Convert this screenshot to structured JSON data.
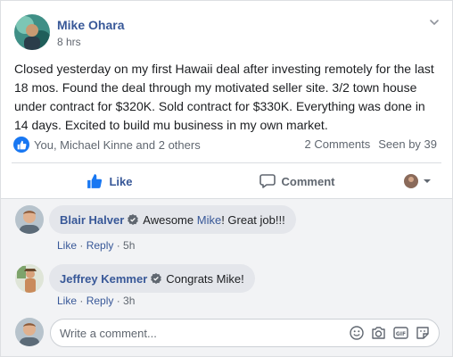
{
  "post": {
    "author": "Mike Ohara",
    "time": "8 hrs",
    "text": "Closed yesterday on my first Hawaii deal after investing remotely for the last 18 mos. Found the deal through my motivated seller site. 3/2 town house under contract for $320K. Sold contract for $330K. Everything was done in 14 days. Excited to build mu business in my own market."
  },
  "reactions": {
    "summary": "You, Michael Kinne and 2 others",
    "comments_count": "2 Comments",
    "seen_by": "Seen by 39"
  },
  "actions": {
    "like": "Like",
    "comment": "Comment"
  },
  "comments": [
    {
      "name": "Blair Halver",
      "text_before": "Awesome ",
      "mention": "Mike",
      "text_after": "! Great job!!!",
      "like": "Like",
      "reply": "Reply",
      "time": "5h"
    },
    {
      "name": "Jeffrey Kemmer",
      "text_before": "Congrats Mike!",
      "like": "Like",
      "reply": "Reply",
      "time": "3h"
    }
  ],
  "composer": {
    "placeholder": "Write a comment..."
  },
  "icons": [
    "chevron-down-icon",
    "like-badge-icon",
    "thumbs-up-icon",
    "comment-icon",
    "emoji-icon",
    "camera-icon",
    "gif-icon",
    "sticker-icon",
    "verified-badge-icon"
  ],
  "colors": {
    "accent": "#385898",
    "like_blue": "#1877f2",
    "bubble": "#e4e6eb"
  },
  "separator": " · "
}
